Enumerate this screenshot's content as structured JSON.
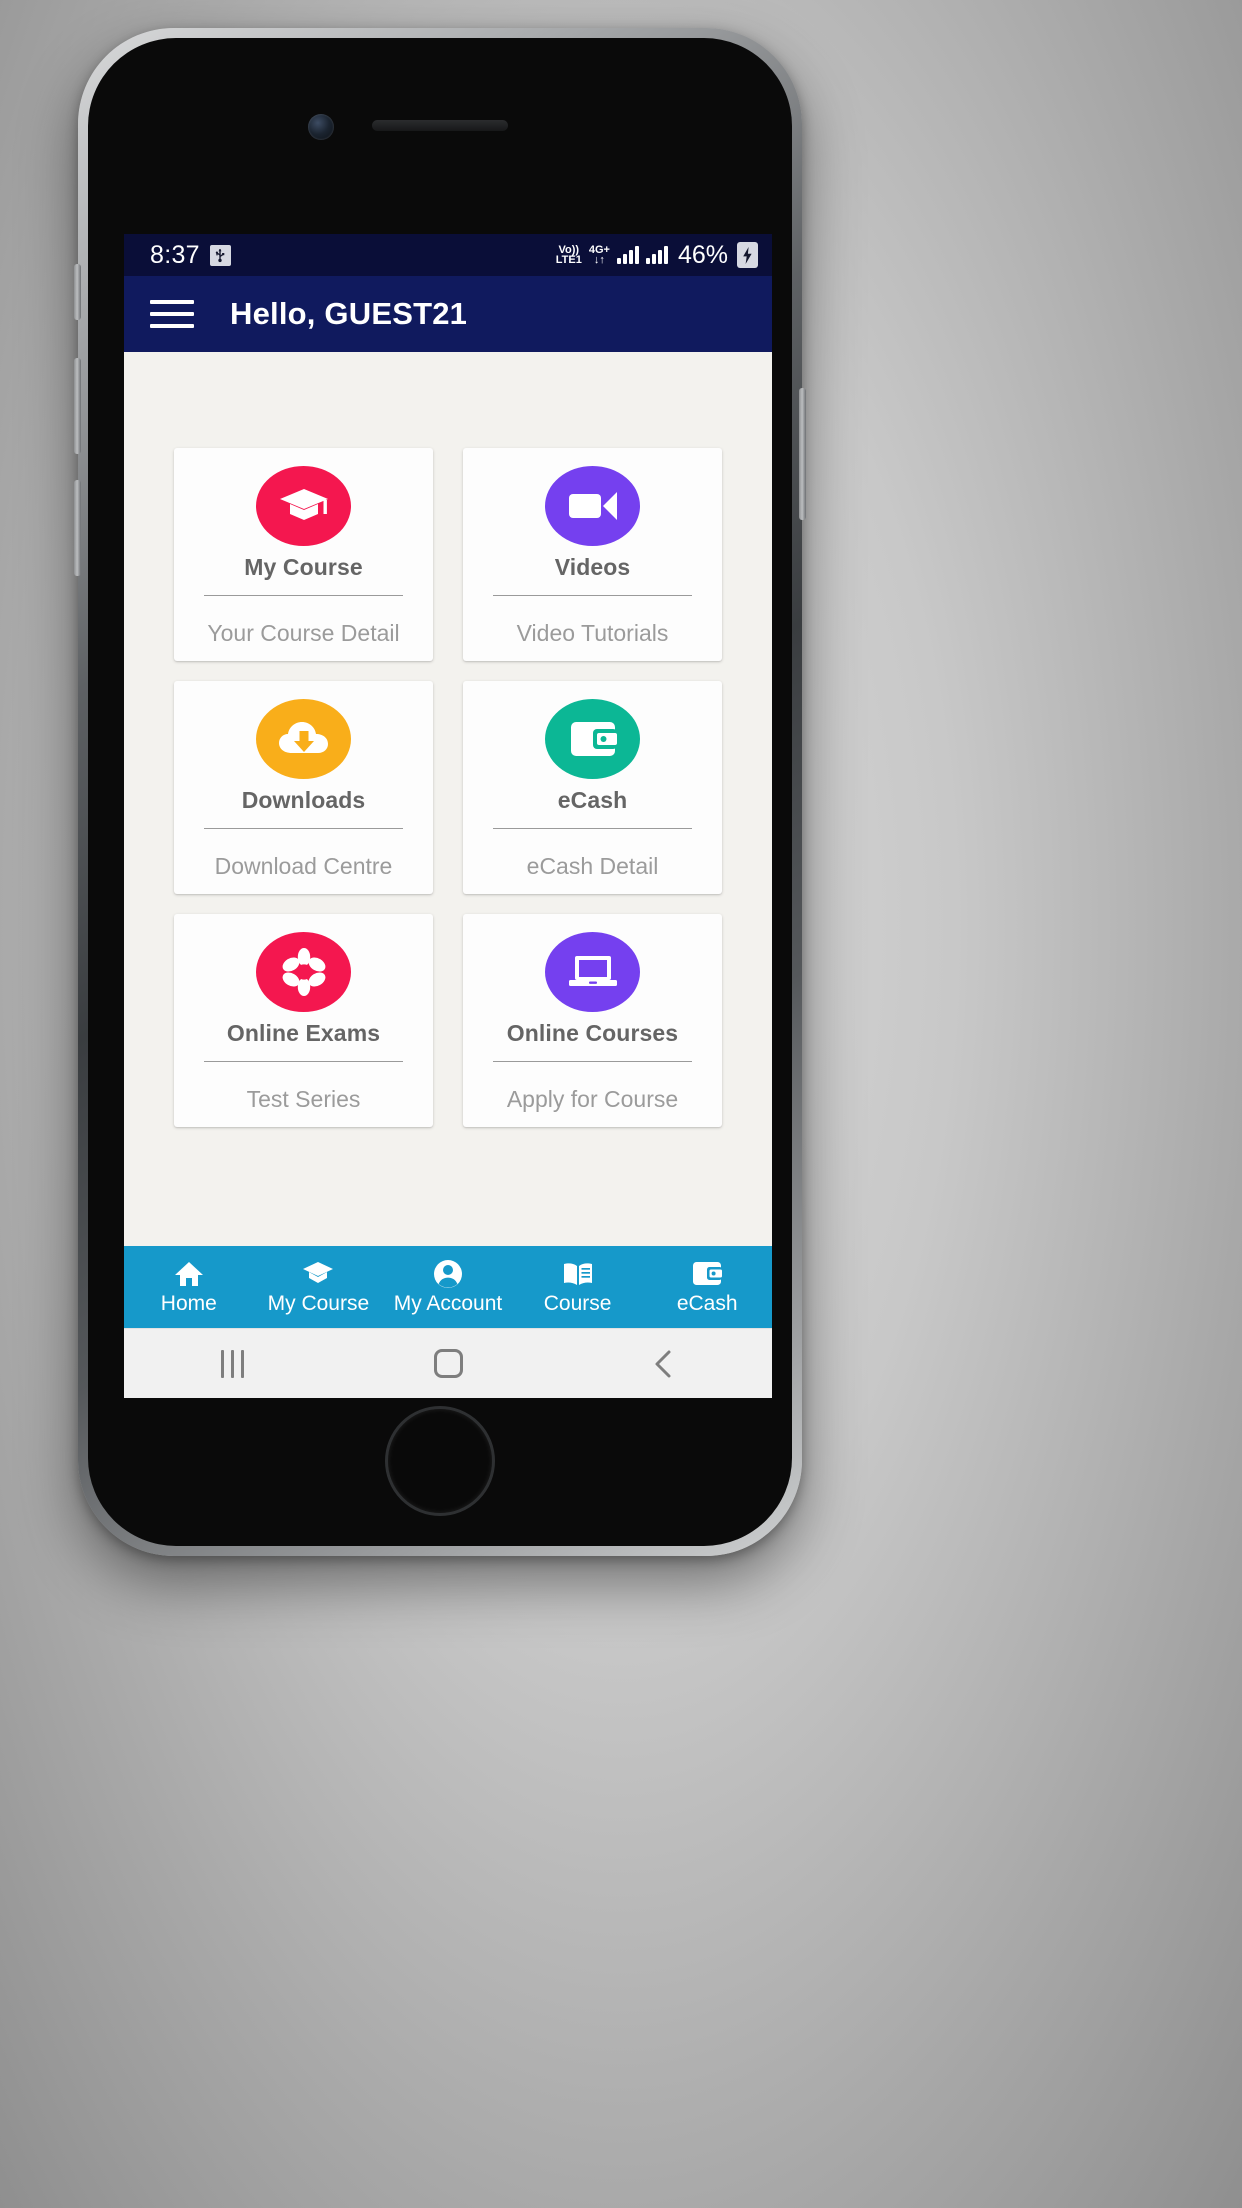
{
  "status_bar": {
    "time": "8:37",
    "usb_icon": "usb-icon",
    "volte_line1": "Vo))",
    "volte_line2": "LTE1",
    "network_type": "4G+",
    "data_arrows": "↓↑",
    "battery_percent": "46%",
    "battery_icon": "battery-charging-icon"
  },
  "app_bar": {
    "menu_icon": "hamburger-menu-icon",
    "title": "Hello, GUEST21",
    "background_color": "#101a5e"
  },
  "dashboard": {
    "cards": [
      {
        "title": "My Course",
        "subtitle": "Your Course Detail",
        "icon": "graduation-cap-icon",
        "color": "#f4174f"
      },
      {
        "title": "Videos",
        "subtitle": "Video Tutorials",
        "icon": "video-camera-icon",
        "color": "#7540ef"
      },
      {
        "title": "Downloads",
        "subtitle": "Download Centre",
        "icon": "cloud-download-icon",
        "color": "#f9ae1a"
      },
      {
        "title": "eCash",
        "subtitle": "eCash Detail",
        "icon": "wallet-icon",
        "color": "#0cb795"
      },
      {
        "title": "Online Exams",
        "subtitle": "Test Series",
        "icon": "flower-icon",
        "color": "#f4174f"
      },
      {
        "title": "Online Courses",
        "subtitle": "Apply for Course",
        "icon": "laptop-icon",
        "color": "#7540ef"
      }
    ]
  },
  "bottom_nav": {
    "background_color": "#1699ca",
    "items": [
      {
        "label": "Home",
        "icon": "home-icon"
      },
      {
        "label": "My Course",
        "icon": "graduation-cap-icon"
      },
      {
        "label": "My Account",
        "icon": "account-circle-icon"
      },
      {
        "label": "Course",
        "icon": "open-book-icon"
      },
      {
        "label": "eCash",
        "icon": "wallet-icon"
      }
    ]
  },
  "system_nav": {
    "recents": "recents-icon",
    "home": "home-square-icon",
    "back": "back-chevron-icon"
  }
}
